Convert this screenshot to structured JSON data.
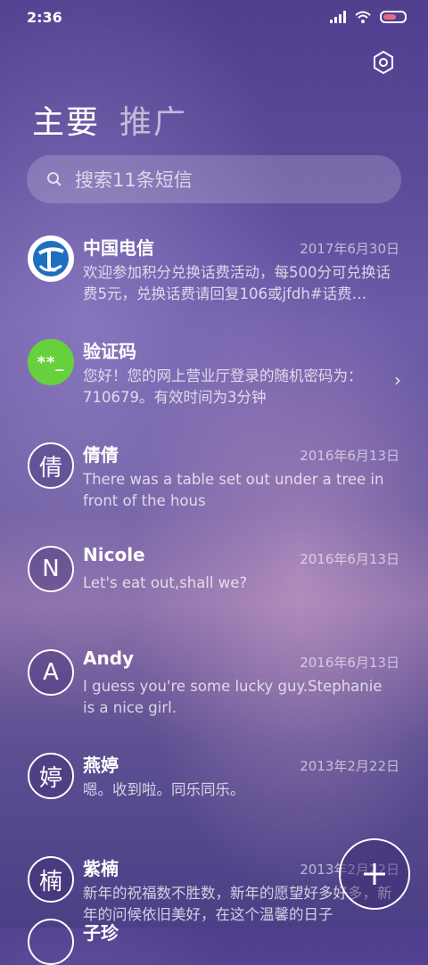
{
  "status_bar": {
    "time": "2:36"
  },
  "tabs": [
    {
      "label": "主要"
    },
    {
      "label": "推广"
    }
  ],
  "search": {
    "text": "搜索11条短信"
  },
  "messages": [
    {
      "name": "中国电信",
      "date": "2017年6月30日",
      "preview": "欢迎参加积分兑换话费活动，每500分可兑换话费5元，兑换话费请回复106或jfdh#话费…",
      "avatar": "china-telecom-logo"
    },
    {
      "name": "验证码",
      "date": "",
      "preview": "您好！您的网上营业厅登录的随机密码为：710679。有效时间为3分钟",
      "avatar_text": "**_"
    },
    {
      "name": "倩倩",
      "date": "2016年6月13日",
      "preview": "There was a table set out under a tree in front of the hous",
      "avatar_text": "倩"
    },
    {
      "name": "Nicole",
      "date": "2016年6月13日",
      "preview": "Let's eat out,shall we?",
      "avatar_text": "N"
    },
    {
      "name": "Andy",
      "date": "2016年6月13日",
      "preview": "I guess you're some lucky guy.Stephanie is a nice girl.",
      "avatar_text": "A"
    },
    {
      "name": "燕婷",
      "date": "2013年2月22日",
      "preview": "嗯。收到啦。同乐同乐。",
      "avatar_text": "婷"
    },
    {
      "name": "紫楠",
      "date": "2013年2月22日",
      "preview": "新年的祝福数不胜数，新年的愿望好多好多，新年的问候依旧美好，在这个温馨的日子",
      "avatar_text": "楠"
    }
  ],
  "partial_item": {
    "name": "子珍"
  },
  "colors": {
    "accent_green": "#66d13c",
    "telecom_blue": "#1f6fc0"
  }
}
